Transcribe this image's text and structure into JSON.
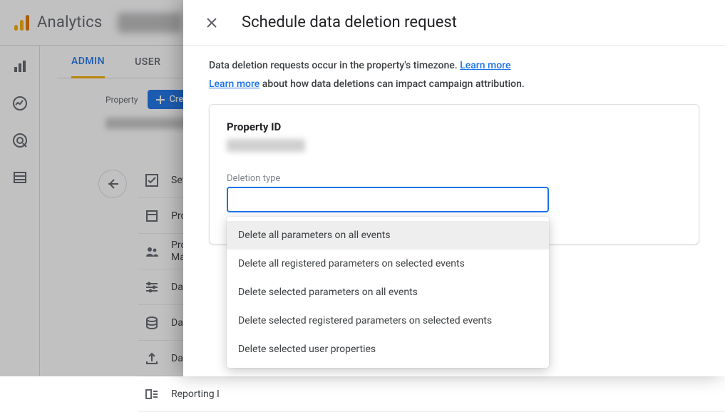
{
  "header": {
    "brand": "Analytics"
  },
  "tabs": {
    "admin": "ADMIN",
    "user": "USER"
  },
  "property_row": {
    "label": "Property",
    "create": "Crea"
  },
  "side_items": [
    "Setup Assis",
    "Property Se",
    "Property Ac\nManageme",
    "Data Strea",
    "Data Settin",
    "Data Impor",
    "Reporting I"
  ],
  "panel": {
    "title": "Schedule data deletion request",
    "info1_pre": "Data deletion requests occur in the property's timezone. ",
    "info1_link": "Learn more",
    "info2_link": "Learn more",
    "info2_post": " about how data deletions can impact campaign attribution.",
    "prop_id_label": "Property ID",
    "deletion_type_label": "Deletion type",
    "options": [
      "Delete all parameters on all events",
      "Delete all registered parameters on selected events",
      "Delete selected parameters on all events",
      "Delete selected registered parameters on selected events",
      "Delete selected user properties"
    ]
  }
}
